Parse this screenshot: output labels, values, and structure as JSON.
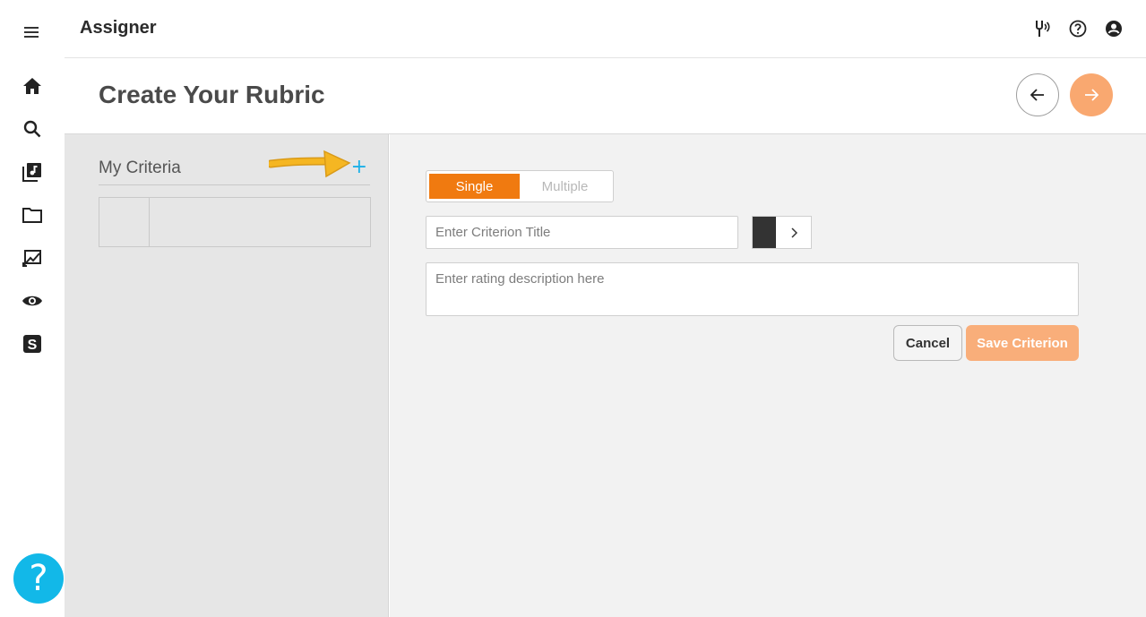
{
  "app": {
    "title": "Assigner"
  },
  "sidebar": {
    "icons": [
      "menu-icon",
      "home-icon",
      "search-icon",
      "library-music-icon",
      "folder-icon",
      "assignment-icon",
      "eye-icon",
      "s-logo-icon"
    ],
    "help_label": "?"
  },
  "topbar": {
    "icons": [
      "tuning-fork-icon",
      "help-circle-icon",
      "account-circle-icon"
    ]
  },
  "page": {
    "title": "Create Your Rubric"
  },
  "criteria_panel": {
    "title": "My Criteria",
    "add_label": "+"
  },
  "editor": {
    "mode_options": [
      "Single",
      "Multiple"
    ],
    "selected_mode": "Single",
    "title_placeholder": "Enter Criterion Title",
    "title_value": "",
    "color_value": "#333333",
    "description_placeholder": "Enter rating description here",
    "description_value": "",
    "cancel_label": "Cancel",
    "save_label": "Save Criterion"
  },
  "colors": {
    "accent": "#f07a10",
    "accent_light": "#f9a870",
    "info": "#12b8e8",
    "annotation_arrow": "#f2b321"
  }
}
